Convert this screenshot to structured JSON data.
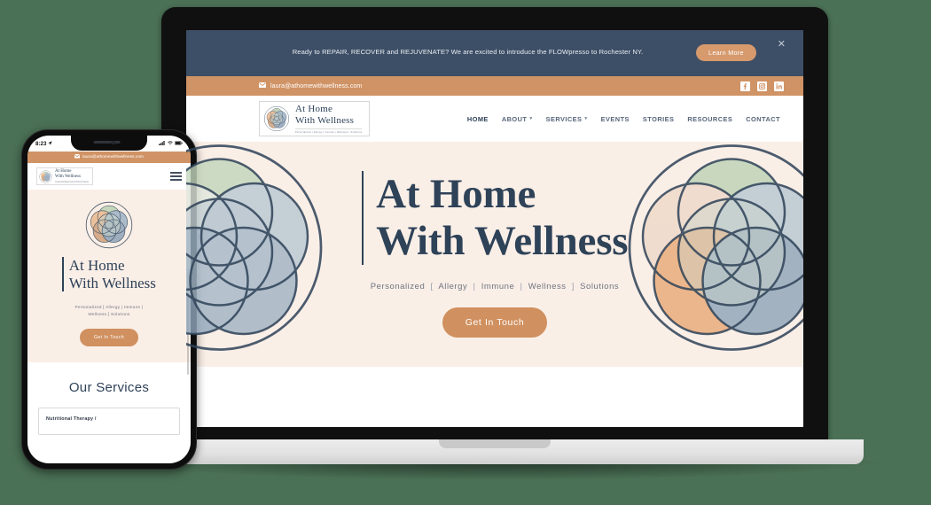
{
  "page": {
    "background_color": "#4a7055",
    "device_mockup": "laptop-and-phone"
  },
  "colors": {
    "navy": "#2e4258",
    "announce_bg": "#3d4f66",
    "terracotta": "#d09365",
    "cta": "#d0905f",
    "hero_bg": "#faefe7",
    "page_bg": "#4a7055"
  },
  "desktop": {
    "announcement": {
      "text": "Ready to REPAIR, RECOVER and REJUVENATE?  We are excited to introduce the FLOWpresso to Rochester NY.",
      "cta_label": "Learn More",
      "close_icon": "close-icon"
    },
    "topbar": {
      "email": "laura@athomewithwellness.com",
      "mail_icon": "mail-icon",
      "social": [
        {
          "name": "facebook-icon",
          "label": "Facebook"
        },
        {
          "name": "instagram-icon",
          "label": "Instagram"
        },
        {
          "name": "linkedin-icon",
          "label": "LinkedIn"
        }
      ]
    },
    "logo": {
      "line1": "At Home",
      "line2": "With Wellness",
      "tagline": "Personalized | Allergy | Immune | Wellness | Solutions"
    },
    "nav": [
      {
        "label": "HOME",
        "active": true,
        "has_dropdown": false
      },
      {
        "label": "ABOUT",
        "active": false,
        "has_dropdown": true
      },
      {
        "label": "SERVICES",
        "active": false,
        "has_dropdown": true
      },
      {
        "label": "EVENTS",
        "active": false,
        "has_dropdown": false
      },
      {
        "label": "STORIES",
        "active": false,
        "has_dropdown": false
      },
      {
        "label": "RESOURCES",
        "active": false,
        "has_dropdown": false
      },
      {
        "label": "CONTACT",
        "active": false,
        "has_dropdown": false
      }
    ],
    "hero": {
      "title_line1": "At Home",
      "title_line2": "With Wellness",
      "sub_1": "Personalized",
      "sub_open": "[",
      "sub_2": "Allergy",
      "sub_3": "Immune",
      "sub_4": "Wellness",
      "sub_close": "]",
      "sub_5": "Solutions",
      "cta_label": "Get In Touch"
    }
  },
  "phone": {
    "status": {
      "time": "8:23",
      "location_icon": "location-arrow-icon",
      "signal_icon": "cellular-signal-icon",
      "wifi_icon": "wifi-icon",
      "battery_icon": "battery-icon"
    },
    "topbar": {
      "email": "laura@athomewithwellness.com",
      "mail_icon": "mail-icon"
    },
    "logo": {
      "line1": "At Home",
      "line2": "With Wellness",
      "tagline": "Personalized | Allergy | Immune | Wellness | Solutions"
    },
    "menu_icon": "hamburger-menu-icon",
    "hero": {
      "title_line1": "At Home",
      "title_line2": "With Wellness",
      "sub_line1": "Personalized  [  Allergy  |  Immune  |",
      "sub_line2": "Wellness  ]  Solutions",
      "cta_label": "Get In Touch"
    },
    "services": {
      "heading": "Our Services",
      "first_card": "Nutritional Therapy /"
    }
  }
}
